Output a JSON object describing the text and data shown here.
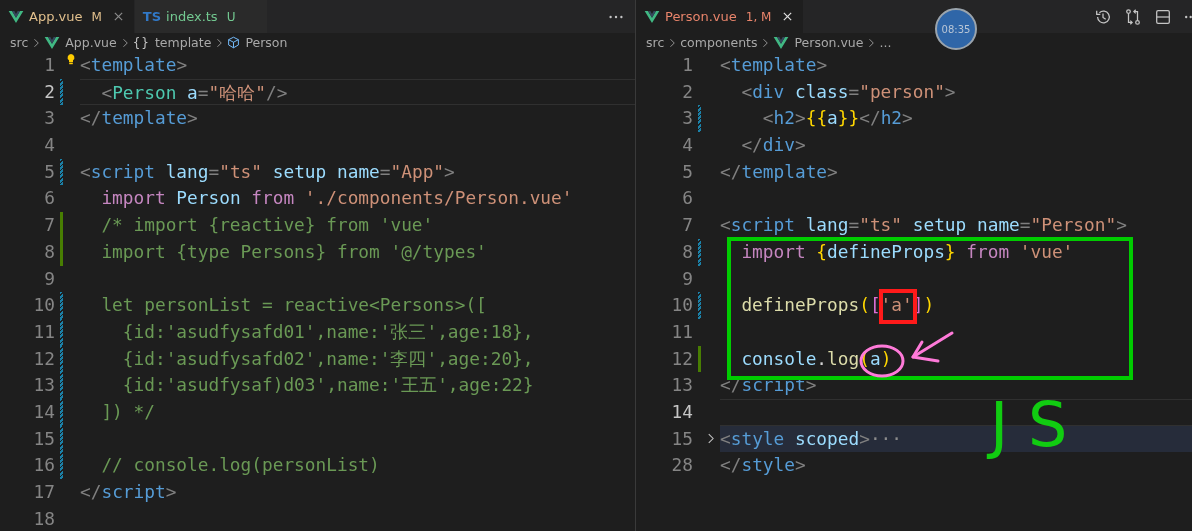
{
  "panes": [
    {
      "tabs": [
        {
          "label": "App.vue",
          "status": "M",
          "color": "#e2c08d",
          "kind": "vue",
          "selected": true
        },
        {
          "label": "index.ts",
          "status": "U",
          "color": "#73c991",
          "kind": "ts",
          "icon_text": "TS",
          "selected": false
        }
      ],
      "breadcrumbs": [
        {
          "label": "src",
          "kind": "plain"
        },
        {
          "label": "App.vue",
          "kind": "vue"
        },
        {
          "label": "template",
          "kind": "braces",
          "glyph": "{}"
        },
        {
          "label": "Person",
          "kind": "cube"
        }
      ],
      "lines": [
        {
          "number": "1",
          "current": false,
          "tokens": [
            {
              "kind": "punct",
              "text": "<"
            },
            {
              "kind": "tag",
              "text": "template"
            },
            {
              "kind": "punct",
              "text": ">"
            }
          ]
        },
        {
          "number": "2",
          "current": true,
          "kind": "modified",
          "tokens": [
            {
              "kind": "punct",
              "text": "  <"
            },
            {
              "kind": "component",
              "text": "Person"
            },
            {
              "kind": "attr",
              "text": " a"
            },
            {
              "kind": "punct",
              "text": "="
            },
            {
              "kind": "string",
              "text": "\"哈哈\""
            },
            {
              "kind": "punct",
              "text": "/>"
            }
          ]
        },
        {
          "number": "3",
          "current": false,
          "tokens": [
            {
              "kind": "punct",
              "text": "</"
            },
            {
              "kind": "tag",
              "text": "template"
            },
            {
              "kind": "punct",
              "text": ">"
            }
          ]
        },
        {
          "number": "4",
          "current": false
        },
        {
          "number": "5",
          "current": false,
          "kind": "modified",
          "tokens": [
            {
              "kind": "punct",
              "text": "<"
            },
            {
              "kind": "tag",
              "text": "script"
            },
            {
              "kind": "attr",
              "text": " lang"
            },
            {
              "kind": "punct",
              "text": "="
            },
            {
              "kind": "string",
              "text": "\"ts\""
            },
            {
              "kind": "attr",
              "text": " setup name"
            },
            {
              "kind": "punct",
              "text": "="
            },
            {
              "kind": "string",
              "text": "\"App\""
            },
            {
              "kind": "punct",
              "text": ">"
            }
          ]
        },
        {
          "number": "6",
          "current": false,
          "tokens": [
            {
              "kind": "keyword",
              "text": "  import"
            },
            {
              "kind": "ident",
              "text": " Person"
            },
            {
              "kind": "keyword",
              "text": " from"
            },
            {
              "kind": "string",
              "text": " './components/Person.vue'"
            }
          ]
        },
        {
          "number": "7",
          "current": false,
          "kind": "added",
          "tokens": [
            {
              "kind": "comment",
              "text": "  /* import {reactive} from 'vue'"
            }
          ]
        },
        {
          "number": "8",
          "current": false,
          "kind": "added",
          "tokens": [
            {
              "kind": "comment",
              "text": "  import {type Persons} from '@/types'"
            }
          ]
        },
        {
          "number": "9",
          "current": false
        },
        {
          "number": "10",
          "current": false,
          "kind": "modified",
          "tokens": [
            {
              "kind": "comment",
              "text": "  let personList = reactive<Persons>(["
            }
          ]
        },
        {
          "number": "11",
          "current": false,
          "kind": "modified",
          "tokens": [
            {
              "kind": "comment",
              "text": "    {id:'asudfysafd01',name:'张三',age:18},"
            }
          ]
        },
        {
          "number": "12",
          "current": false,
          "kind": "modified",
          "tokens": [
            {
              "kind": "comment",
              "text": "    {id:'asudfysafd02',name:'李四',age:20},"
            }
          ]
        },
        {
          "number": "13",
          "current": false,
          "kind": "modified",
          "tokens": [
            {
              "kind": "comment",
              "text": "    {id:'asudfysaf)d03',name:'王五',age:22}"
            }
          ]
        },
        {
          "number": "14",
          "current": false,
          "kind": "modified",
          "tokens": [
            {
              "kind": "comment",
              "text": "  ]) */"
            }
          ]
        },
        {
          "number": "15",
          "current": false,
          "kind": "modified"
        },
        {
          "number": "16",
          "current": false,
          "kind": "modified",
          "tokens": [
            {
              "kind": "comment",
              "text": "  // console.log(personList)"
            }
          ]
        },
        {
          "number": "17",
          "current": false,
          "tokens": [
            {
              "kind": "punct",
              "text": "</"
            },
            {
              "kind": "tag",
              "text": "script"
            },
            {
              "kind": "punct",
              "text": ">"
            }
          ]
        },
        {
          "number": "18",
          "current": false
        }
      ]
    },
    {
      "tabs": [
        {
          "label": "Person.vue",
          "status": "1, M",
          "color": "#e8846b",
          "kind": "vue",
          "selected": true
        }
      ],
      "breadcrumbs": [
        {
          "label": "src",
          "kind": "plain"
        },
        {
          "label": "components",
          "kind": "plain"
        },
        {
          "label": "Person.vue",
          "kind": "vue"
        },
        {
          "label": "...",
          "kind": "plain"
        }
      ],
      "timer": "08:35",
      "lines": [
        {
          "number": "1",
          "current": false,
          "folded": false,
          "tokens": [
            {
              "kind": "punct",
              "text": "<"
            },
            {
              "kind": "tag",
              "text": "template"
            },
            {
              "kind": "punct",
              "text": ">"
            }
          ]
        },
        {
          "number": "2",
          "current": false,
          "folded": false,
          "tokens": [
            {
              "kind": "punct",
              "text": "  <"
            },
            {
              "kind": "tag",
              "text": "div"
            },
            {
              "kind": "attr",
              "text": " class"
            },
            {
              "kind": "punct",
              "text": "="
            },
            {
              "kind": "string",
              "text": "\"person\""
            },
            {
              "kind": "punct",
              "text": ">"
            }
          ]
        },
        {
          "number": "3",
          "current": false,
          "folded": false,
          "kind": "modified",
          "tokens": [
            {
              "kind": "punct",
              "text": "    <"
            },
            {
              "kind": "tag",
              "text": "h2"
            },
            {
              "kind": "punct",
              "text": ">"
            },
            {
              "kind": "brace",
              "text": "{{"
            },
            {
              "kind": "ident",
              "text": "a"
            },
            {
              "kind": "brace",
              "text": "}}"
            },
            {
              "kind": "punct",
              "text": "</"
            },
            {
              "kind": "tag",
              "text": "h2"
            },
            {
              "kind": "punct",
              "text": ">"
            }
          ]
        },
        {
          "number": "4",
          "current": false,
          "folded": false,
          "tokens": [
            {
              "kind": "punct",
              "text": "  </"
            },
            {
              "kind": "tag",
              "text": "div"
            },
            {
              "kind": "punct",
              "text": ">"
            }
          ]
        },
        {
          "number": "5",
          "current": false,
          "folded": false,
          "tokens": [
            {
              "kind": "punct",
              "text": "</"
            },
            {
              "kind": "tag",
              "text": "template"
            },
            {
              "kind": "punct",
              "text": ">"
            }
          ]
        },
        {
          "number": "6",
          "current": false,
          "folded": false
        },
        {
          "number": "7",
          "current": false,
          "folded": false,
          "tokens": [
            {
              "kind": "punct",
              "text": "<"
            },
            {
              "kind": "tag",
              "text": "script"
            },
            {
              "kind": "attr",
              "text": " lang"
            },
            {
              "kind": "punct",
              "text": "="
            },
            {
              "kind": "string",
              "text": "\"ts\""
            },
            {
              "kind": "attr",
              "text": " setup name"
            },
            {
              "kind": "punct",
              "text": "="
            },
            {
              "kind": "string",
              "text": "\"Person\""
            },
            {
              "kind": "punct",
              "text": ">"
            }
          ]
        },
        {
          "number": "8",
          "current": false,
          "folded": false,
          "kind": "modified",
          "tokens": [
            {
              "kind": "keyword",
              "text": "  import"
            },
            {
              "kind": "brace",
              "text": " {"
            },
            {
              "kind": "ident",
              "text": "defineProps"
            },
            {
              "kind": "brace",
              "text": "}"
            },
            {
              "kind": "keyword",
              "text": " from"
            },
            {
              "kind": "string",
              "text": " 'vue'"
            }
          ]
        },
        {
          "number": "9",
          "current": false,
          "folded": false
        },
        {
          "number": "10",
          "current": false,
          "folded": false,
          "kind": "modified",
          "tokens": [
            {
              "kind": "func",
              "text": "  defineProps"
            },
            {
              "kind": "brace",
              "text": "("
            },
            {
              "kind": "bracket",
              "text": "["
            },
            {
              "kind": "string",
              "text": "'a'"
            },
            {
              "kind": "bracket",
              "text": "]"
            },
            {
              "kind": "brace",
              "text": ")"
            }
          ]
        },
        {
          "number": "11",
          "current": false,
          "folded": false
        },
        {
          "number": "12",
          "current": false,
          "folded": false,
          "kind": "added",
          "tokens": [
            {
              "kind": "ident",
              "text": "  console"
            },
            {
              "kind": "plain",
              "text": "."
            },
            {
              "kind": "func",
              "text": "log"
            },
            {
              "kind": "brace",
              "text": "("
            },
            {
              "kind": "ident",
              "text": "a"
            },
            {
              "kind": "brace",
              "text": ")"
            }
          ]
        },
        {
          "number": "13",
          "current": false,
          "folded": false,
          "tokens": [
            {
              "kind": "punct",
              "text": "</"
            },
            {
              "kind": "tag",
              "text": "script"
            },
            {
              "kind": "punct",
              "text": ">"
            }
          ]
        },
        {
          "number": "14",
          "current": true,
          "folded": false
        },
        {
          "number": "15",
          "current": false,
          "folded": true,
          "tokens": [
            {
              "kind": "punct",
              "text": "<"
            },
            {
              "kind": "tag",
              "text": "style"
            },
            {
              "kind": "attr",
              "text": " scoped"
            },
            {
              "kind": "punct",
              "text": ">"
            },
            {
              "kind": "fold",
              "text": "···"
            }
          ]
        },
        {
          "number": "28",
          "current": false,
          "folded": false,
          "tokens": [
            {
              "kind": "punct",
              "text": "</"
            },
            {
              "kind": "tag",
              "text": "style"
            },
            {
              "kind": "punct",
              "text": ">"
            }
          ]
        }
      ],
      "annotations": [
        {
          "kind": "rectangle",
          "color": "#00cc00"
        },
        {
          "kind": "rectangle",
          "color": "#ff1a1a"
        },
        {
          "kind": "circle",
          "color": "#ff7ad9"
        },
        {
          "kind": "arrow",
          "color": "#ff7ad9"
        },
        {
          "kind": "handwriting",
          "text": "J S",
          "color": "#11cc11"
        }
      ]
    }
  ]
}
